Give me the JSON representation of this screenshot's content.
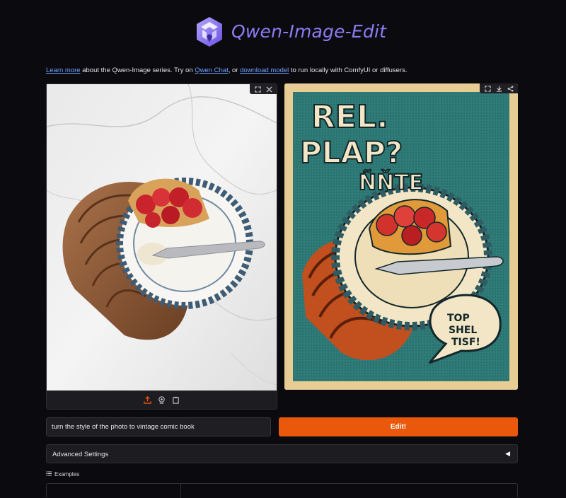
{
  "header": {
    "brand": "Qwen-Image-Edit",
    "logo_icon": "qwen-logo"
  },
  "intro": {
    "link_learn": "Learn more",
    "text_1": " about the Qwen-Image series. Try on ",
    "link_chat": "Qwen Chat",
    "text_2": ", or ",
    "link_download": "download model",
    "text_3": " to run locally with ComfyUI or diffusers."
  },
  "input_panel": {
    "tools": [
      "fullscreen-icon",
      "close-icon"
    ],
    "sources": [
      "upload-icon",
      "webcam-icon",
      "clipboard-icon"
    ]
  },
  "output_panel": {
    "tools": [
      "fullscreen-icon",
      "download-icon",
      "share-icon"
    ],
    "comic_title_line1": "REL.",
    "comic_title_line2": "PLAP?",
    "comic_title_line3": "ÑŇTE",
    "bubble_line1": "TOP",
    "bubble_line2": "SHEL",
    "bubble_line3": "TISF!"
  },
  "prompt": {
    "value": "turn the style of the photo to vintage comic book"
  },
  "edit_button": {
    "label": "Edit!"
  },
  "advanced": {
    "label": "Advanced Settings",
    "arrow": "◀"
  },
  "examples": {
    "label": "Examples",
    "icon": "list-icon"
  },
  "colors": {
    "accent": "#ea580c",
    "brand": "#8b7cf3",
    "link": "#6fa0ff"
  }
}
